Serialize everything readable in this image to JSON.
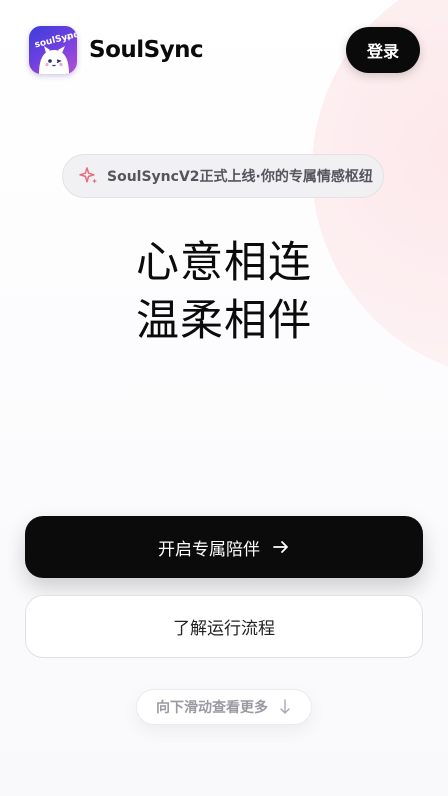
{
  "header": {
    "brand": "SoulSync",
    "logo_text": "soulSync",
    "login_label": "登录"
  },
  "announcement": {
    "icon": "sparkle-icon",
    "text": "SoulSyncV2正式上线·你的专属情感枢纽"
  },
  "hero": {
    "line1": "心意相连",
    "line2": "温柔相伴"
  },
  "actions": {
    "primary_label": "开启专属陪伴",
    "primary_icon": "arrow-right-icon",
    "secondary_label": "了解运行流程"
  },
  "scroll_hint": {
    "text": "向下滑动查看更多",
    "icon": "arrow-down-icon"
  },
  "colors": {
    "primary": "#0b0b0c",
    "accent_pink": "#e86b7e",
    "background": "#fbfbfc",
    "logo_gradient_start": "#3b3fd8",
    "logo_gradient_end": "#b44fd6"
  }
}
